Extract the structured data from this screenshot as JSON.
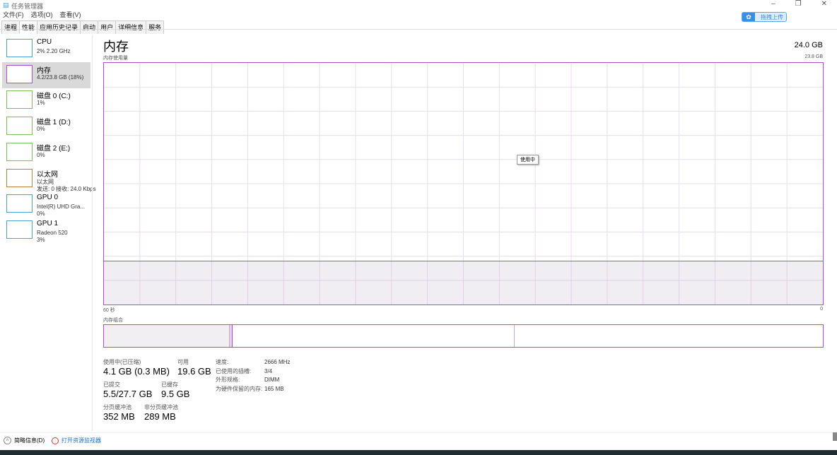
{
  "window": {
    "title": "任务管理器",
    "controls": [
      "–",
      "❐",
      "✕"
    ]
  },
  "menu": [
    "文件(F)",
    "选项(O)",
    "查看(V)"
  ],
  "tabs": [
    {
      "label": "进程"
    },
    {
      "label": "性能",
      "active": true
    },
    {
      "label": "应用历史记录"
    },
    {
      "label": "启动"
    },
    {
      "label": "用户"
    },
    {
      "label": "详细信息"
    },
    {
      "label": "服务"
    }
  ],
  "upload_button": "拖拽上传",
  "sidebar": [
    {
      "name": "CPU",
      "sub1": "2% 2.20 GHz",
      "color": "#4aa3d8"
    },
    {
      "name": "内存",
      "sub1": "4.2/23.8 GB (18%)",
      "color": "#a94fd0",
      "selected": true
    },
    {
      "name": "磁盘 0 (C:)",
      "sub1": "1%",
      "color": "#7cc05a"
    },
    {
      "name": "磁盘 1 (D:)",
      "sub1": "0%",
      "color": "#7cc05a"
    },
    {
      "name": "磁盘 2 (E:)",
      "sub1": "0%",
      "color": "#7cc05a"
    },
    {
      "name": "以太网",
      "sub1": "以太网",
      "sub2": "发送: 0 接收: 24.0 Kbps",
      "color": "#c57a3a"
    },
    {
      "name": "GPU 0",
      "sub1": "Intel(R) UHD Gra...",
      "sub2": "0%",
      "color": "#4aa3d8"
    },
    {
      "name": "GPU 1",
      "sub1": "Radeon 520",
      "sub2": "3%",
      "color": "#4aa3d8"
    }
  ],
  "main": {
    "title": "内存",
    "total": "24.0 GB",
    "usage_label": "内存使用量",
    "max_label": "23.8 GB",
    "tooltip": "使用中",
    "time_left": "60 秒",
    "time_right": "0",
    "composition_label": "内存组合",
    "usage_fraction": 0.18,
    "stats": {
      "in_use_label": "使用中(已压缩)",
      "in_use": "4.1 GB (0.3 MB)",
      "available_label": "可用",
      "available": "19.6 GB",
      "committed_label": "已提交",
      "committed": "5.5/27.7 GB",
      "cached_label": "已缓存",
      "cached": "9.5 GB",
      "paged_label": "分页缓冲池",
      "paged": "352 MB",
      "nonpaged_label": "非分页缓冲池",
      "nonpaged": "289 MB"
    },
    "details": [
      {
        "k": "速度:",
        "v": "2666 MHz"
      },
      {
        "k": "已使用的插槽:",
        "v": "3/4"
      },
      {
        "k": "外形规格:",
        "v": "DIMM"
      },
      {
        "k": "为硬件保留的内存:",
        "v": "165 MB"
      }
    ]
  },
  "footer": {
    "less_details": "简略信息(D)",
    "open_monitor": "打开资源监视器"
  },
  "colors": {
    "memory": "#a94fd0",
    "accent": "#3a8ee6"
  }
}
